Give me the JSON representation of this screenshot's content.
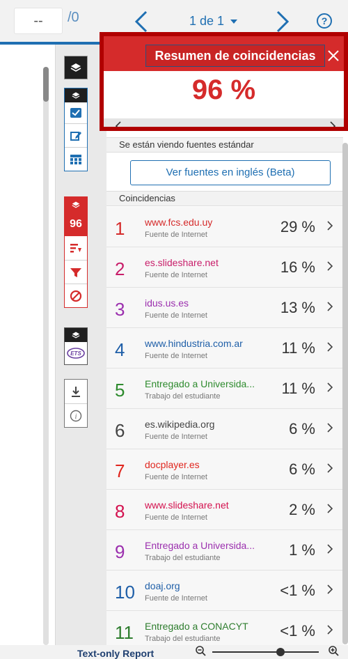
{
  "toolbar": {
    "page_input_value": "--",
    "page_total": "/0",
    "page_count": "1 de 1",
    "help_label": "?"
  },
  "summary": {
    "title": "Resumen de coincidencias",
    "value": "96 %"
  },
  "side_tools": {
    "match_count": "96"
  },
  "panel": {
    "standard_sources_label": "Se están viendo fuentes estándar",
    "english_button": "Ver fuentes en inglés (Beta)",
    "matches_header": "Coincidencias",
    "matches": [
      {
        "num": "1",
        "name": "www.fcs.edu.uy",
        "type": "Fuente de Internet",
        "pct": "29 %",
        "color": "#d52b2b"
      },
      {
        "num": "2",
        "name": "es.slideshare.net",
        "type": "Fuente de Internet",
        "pct": "16 %",
        "color": "#c81e6a"
      },
      {
        "num": "3",
        "name": "idus.us.es",
        "type": "Fuente de Internet",
        "pct": "13 %",
        "color": "#9b2fae"
      },
      {
        "num": "4",
        "name": "www.hindustria.com.ar",
        "type": "Fuente de Internet",
        "pct": "11 %",
        "color": "#1f5fa8"
      },
      {
        "num": "5",
        "name": "Entregado a Universida...",
        "type": "Trabajo del estudiante",
        "pct": "11 %",
        "color": "#2e8b2e"
      },
      {
        "num": "6",
        "name": "es.wikipedia.org",
        "type": "Fuente de Internet",
        "pct": "6 %",
        "color": "#444444"
      },
      {
        "num": "7",
        "name": "docplayer.es",
        "type": "Fuente de Internet",
        "pct": "6 %",
        "color": "#e0261e"
      },
      {
        "num": "8",
        "name": "www.slideshare.net",
        "type": "Fuente de Internet",
        "pct": "2 %",
        "color": "#d3124f"
      },
      {
        "num": "9",
        "name": "Entregado a Universida...",
        "type": "Trabajo del estudiante",
        "pct": "1 %",
        "color": "#9b2fae"
      },
      {
        "num": "10",
        "name": "doaj.org",
        "type": "Fuente de Internet",
        "pct": "<1 %",
        "color": "#1f5fa8"
      },
      {
        "num": "11",
        "name": "Entregado a CONACYT",
        "type": "Trabajo del estudiante",
        "pct": "<1 %",
        "color": "#2e7d2e"
      }
    ]
  },
  "bottom": {
    "text_only_report": "Text-only Report"
  },
  "colors": {
    "accent_blue": "#1f6fb2",
    "match_red": "#d52b2b"
  }
}
